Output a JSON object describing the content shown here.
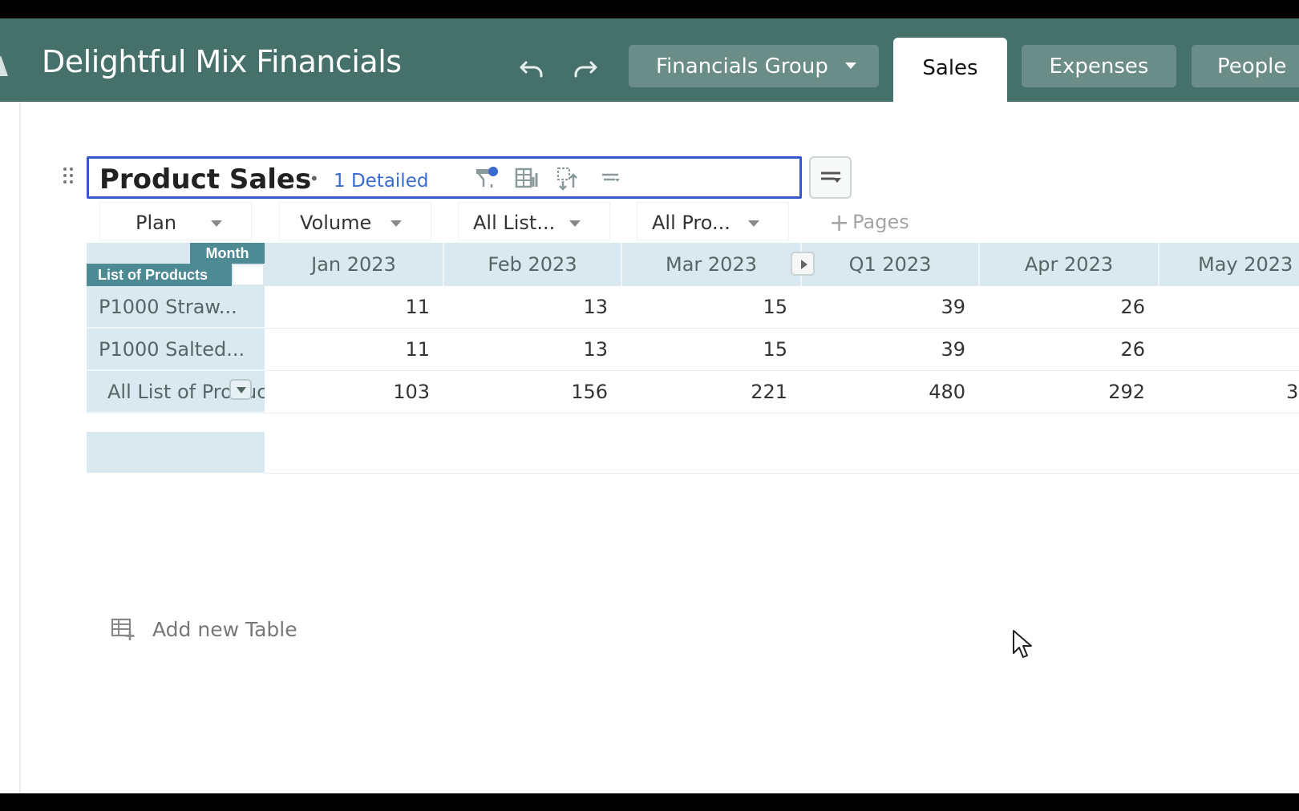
{
  "header": {
    "app_title": "Delightful Mix Financials",
    "group_label": "Financials Group",
    "tabs": [
      {
        "label": "Sales",
        "active": true
      },
      {
        "label": "Expenses",
        "active": false
      },
      {
        "label": "People",
        "active": false
      }
    ],
    "colors": {
      "header_bg": "#46716b",
      "tab_bg": "#6a8d87",
      "selection_border": "#3657c8"
    }
  },
  "table": {
    "title": "Product Sales",
    "separator": "•",
    "detail_link": "1 Detailed",
    "filters": [
      "Plan",
      "Volume",
      "All List...",
      "All Pro..."
    ],
    "pages_label": "Pages",
    "corner": {
      "column_dimension": "Month",
      "row_dimension": "List of Products"
    },
    "columns": [
      "Jan 2023",
      "Feb 2023",
      "Mar 2023",
      "Q1 2023",
      "Apr 2023",
      "May 2023"
    ],
    "rows": [
      {
        "label": "P1000 Straw...",
        "values": [
          "11",
          "13",
          "15",
          "39",
          "26",
          ""
        ]
      },
      {
        "label": "P1000 Salted...",
        "values": [
          "11",
          "13",
          "15",
          "39",
          "26",
          ""
        ]
      },
      {
        "label": "All List of Produc",
        "values": [
          "103",
          "156",
          "221",
          "480",
          "292",
          "3"
        ]
      }
    ]
  },
  "footer": {
    "add_table_label": "Add new Table"
  }
}
